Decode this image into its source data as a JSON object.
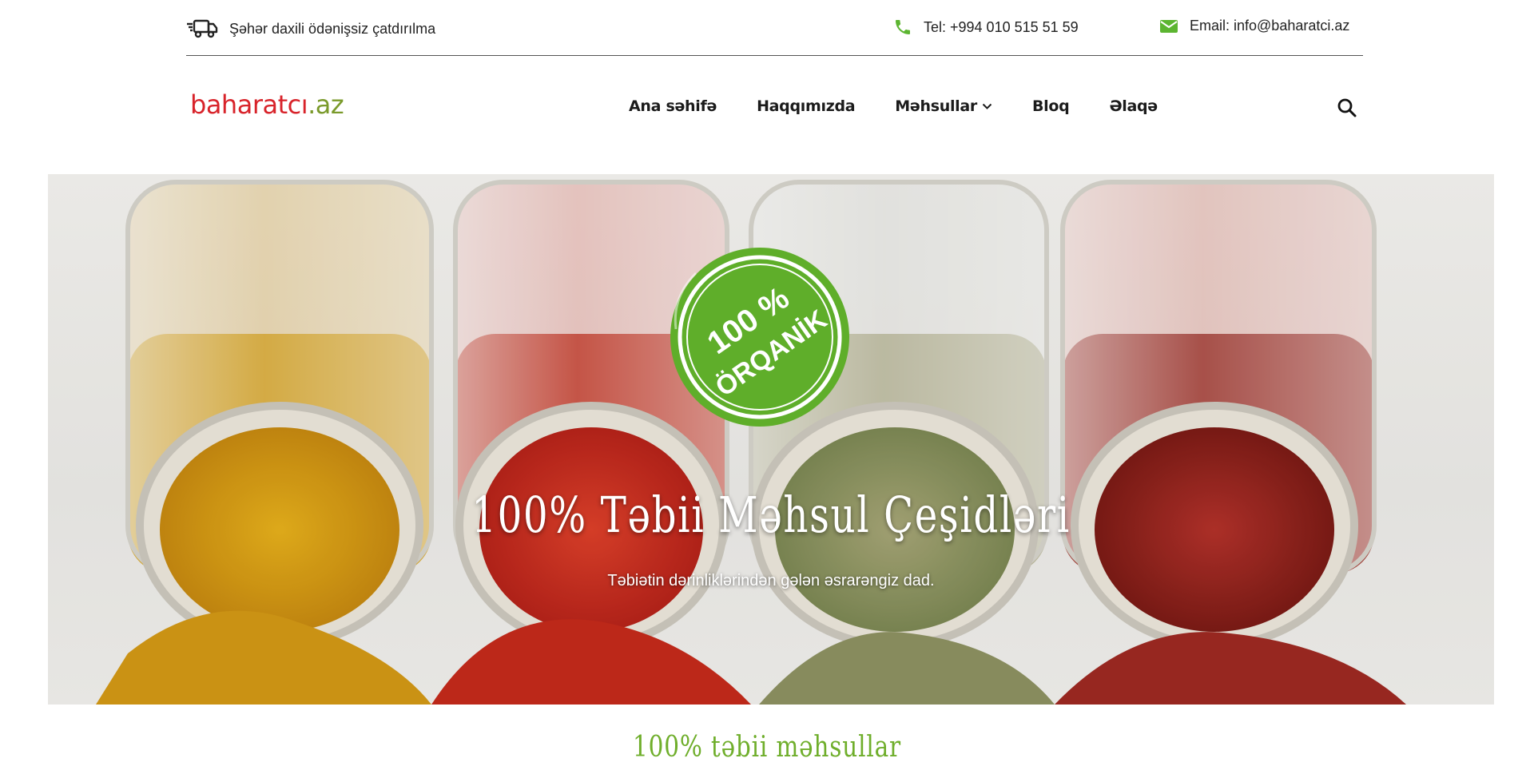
{
  "topbar": {
    "delivery_text": "Şəhər daxili ödənişsiz çatdırılma",
    "phone_text": "Tel: +994 010 515 51 59",
    "email_text": "Email: info@baharatci.az"
  },
  "logo": {
    "part1": "baharatcı",
    "part2": ".az"
  },
  "nav": {
    "items": [
      {
        "label": "Ana səhifə"
      },
      {
        "label": "Haqqımızda"
      },
      {
        "label": "Məhsullar"
      },
      {
        "label": "Bloq"
      },
      {
        "label": "Əlaqə"
      }
    ]
  },
  "hero": {
    "badge_line1": "100 %",
    "badge_line2": "ÖRQANİK",
    "title": "100% Təbii Məhsul Çeşidləri",
    "subtitle": "Təbiətin dərinliklərindən gələn əsrarəngiz dad."
  },
  "section": {
    "title": "100% təbii məhsullar"
  },
  "colors": {
    "accent_green": "#6fae2b",
    "logo_red": "#d8232a",
    "logo_green": "#7a9a2b",
    "icon_green": "#5cb531"
  }
}
